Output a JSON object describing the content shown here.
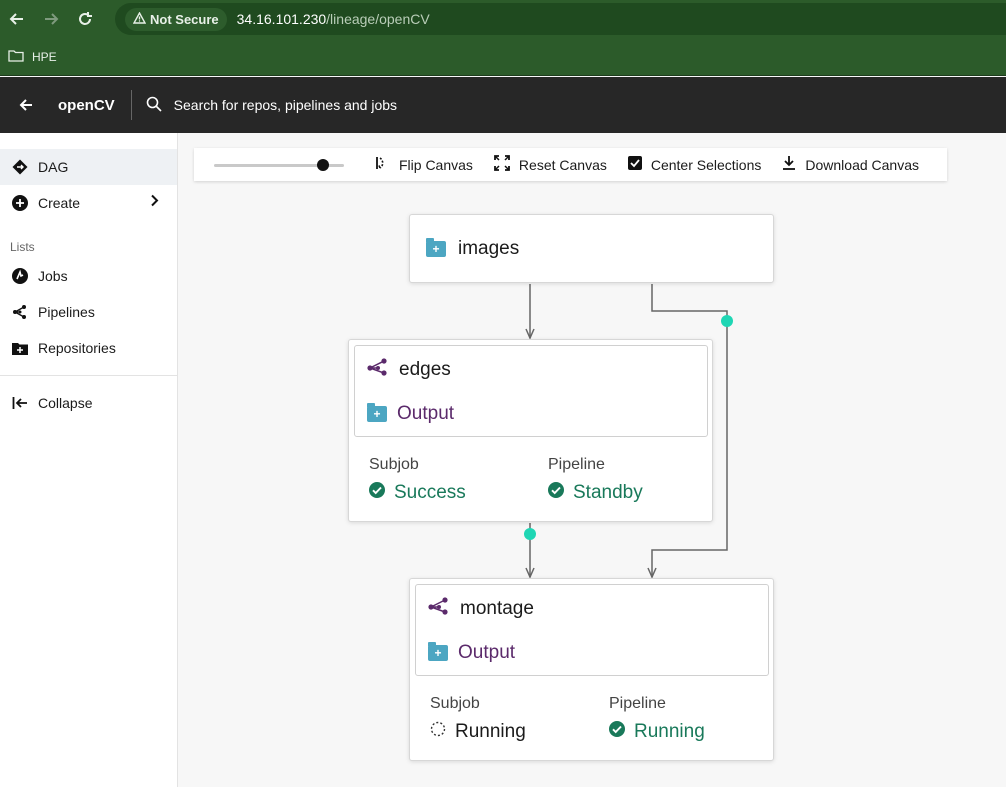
{
  "browser": {
    "security_label": "Not Secure",
    "url_host": "34.16.101.230",
    "url_path": "/lineage/openCV",
    "bookmark_label": "HPE"
  },
  "header": {
    "project": "openCV",
    "search_placeholder": "Search for repos, pipelines and jobs"
  },
  "sidebar": {
    "dag_label": "DAG",
    "create_label": "Create",
    "lists_heading": "Lists",
    "items": [
      {
        "label": "Jobs"
      },
      {
        "label": "Pipelines"
      },
      {
        "label": "Repositories"
      }
    ],
    "collapse_label": "Collapse"
  },
  "toolbar": {
    "zoom_level": 0.87,
    "flip_label": "Flip Canvas",
    "reset_label": "Reset Canvas",
    "center_label": "Center Selections",
    "download_label": "Download Canvas"
  },
  "dag": {
    "repo": {
      "name": "images"
    },
    "pipelines": [
      {
        "name": "edges",
        "output_label": "Output",
        "subjob_heading": "Subjob",
        "subjob_status": "Success",
        "pipeline_heading": "Pipeline",
        "pipeline_status": "Standby"
      },
      {
        "name": "montage",
        "output_label": "Output",
        "subjob_heading": "Subjob",
        "subjob_status": "Running",
        "pipeline_heading": "Pipeline",
        "pipeline_status": "Running"
      }
    ]
  },
  "colors": {
    "browser_bar": "#2c5b2a",
    "app_header": "#272727",
    "success": "#19795a",
    "pipeline_icon": "#5b2a6b",
    "repo_folder": "#4ca6c2",
    "edge_dot": "#1fd6b4"
  },
  "icons": {
    "back": "arrow-left-icon",
    "forward": "arrow-right-icon",
    "reload": "reload-icon",
    "warning": "warning-triangle-icon",
    "folder": "folder-icon",
    "search": "search-icon",
    "dag": "dag-icon",
    "create": "plus-circle-icon",
    "jobs": "jobs-icon",
    "pipelines": "pipeline-icon",
    "repositories": "repository-icon",
    "collapse": "collapse-icon"
  }
}
